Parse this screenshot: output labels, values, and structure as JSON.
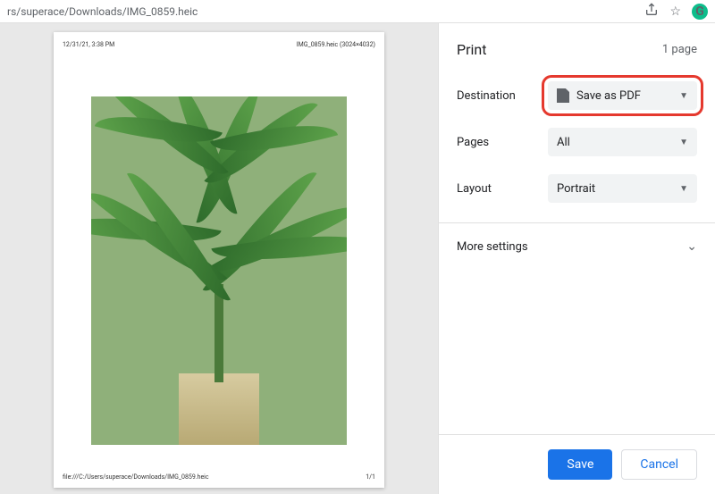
{
  "address_bar": {
    "path": "rs/superace/Downloads/IMG_0859.heic"
  },
  "preview": {
    "timestamp": "12/31/21, 3:38 PM",
    "filename_dim": "IMG_0859.heic (3024×4032)",
    "footer_path": "file:///C:/Users/superace/Downloads/IMG_0859.heic",
    "page_num": "1/1"
  },
  "panel": {
    "title": "Print",
    "page_count": "1 page",
    "settings": {
      "destination": {
        "label": "Destination",
        "value": "Save as PDF"
      },
      "pages": {
        "label": "Pages",
        "value": "All"
      },
      "layout": {
        "label": "Layout",
        "value": "Portrait"
      }
    },
    "more_label": "More settings",
    "save_label": "Save",
    "cancel_label": "Cancel"
  }
}
